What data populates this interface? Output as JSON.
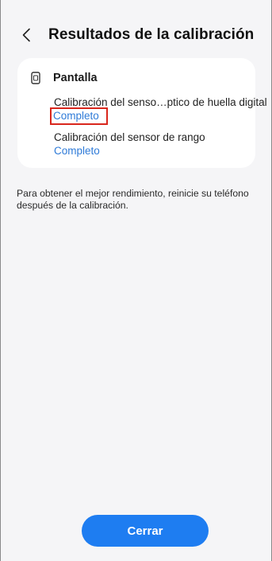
{
  "header": {
    "title": "Resultados de la calibración"
  },
  "card": {
    "section_title": "Pantalla",
    "section_icon": "phone-screen-icon",
    "items": [
      {
        "name": "Calibración del senso…ptico de huella digital",
        "status": "Completo"
      },
      {
        "name": "Calibración del sensor de rango",
        "status": "Completo"
      }
    ]
  },
  "note": "Para obtener el mejor rendimiento, reinicie su teléfono después de la calibración.",
  "footer": {
    "close_label": "Cerrar"
  },
  "colors": {
    "background": "#f5f5f7",
    "card": "#ffffff",
    "accent": "#1e7df1",
    "status_text": "#2f7bd8",
    "highlight_box": "#d9261c"
  },
  "icons": {
    "back": "chevron-left-icon"
  }
}
